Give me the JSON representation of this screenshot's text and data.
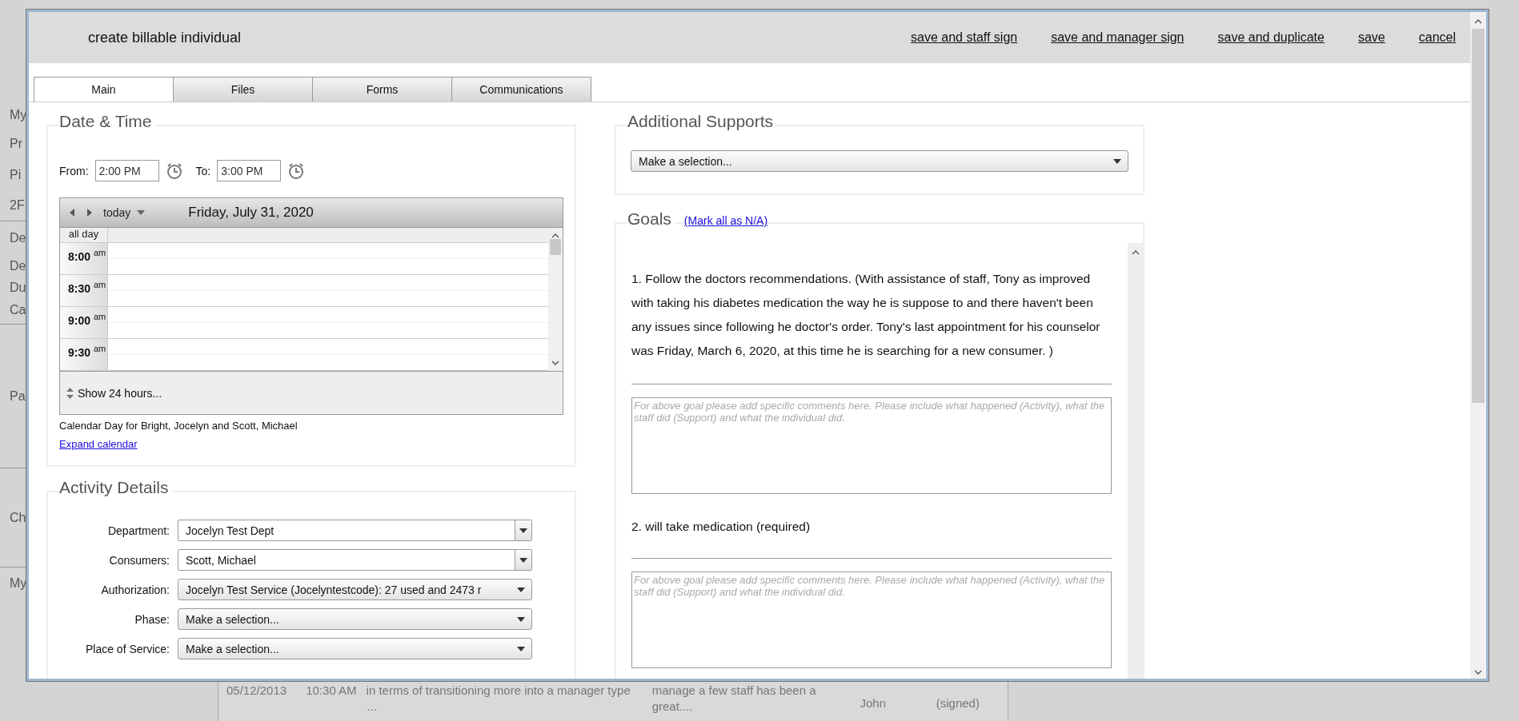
{
  "background": {
    "side_items": [
      "My",
      "Pr",
      "Pi",
      "2F",
      "De",
      "De",
      "Du",
      "Ca",
      "Pa",
      "Ch",
      "My"
    ],
    "bottom_row": {
      "date": "05/12/2013",
      "time": "10:30 AM",
      "note": "in terms of transitioning more into a manager type",
      "note_more": "...",
      "summary": "manage a few staff has been a",
      "summary_more": "great....",
      "staff": "John",
      "signed": "(signed)"
    }
  },
  "dialog": {
    "title": "create billable individual",
    "actions": [
      "save and staff sign",
      "save and manager sign",
      "save and duplicate",
      "save",
      "cancel"
    ],
    "tabs": [
      {
        "label": "Main",
        "selected": true
      },
      {
        "label": "Files",
        "selected": false
      },
      {
        "label": "Forms",
        "selected": false
      },
      {
        "label": "Communications",
        "selected": false
      }
    ],
    "date_time": {
      "title": "Date & Time",
      "from_label": "From:",
      "from_value": "2:00 PM",
      "to_label": "To:",
      "to_value": "3:00 PM",
      "calendar": {
        "today_label": "today",
        "date": "Friday, July 31, 2020",
        "all_day_label": "all day",
        "times": [
          {
            "hour": "8:00",
            "suffix": "am"
          },
          {
            "hour": "8:30",
            "suffix": "am"
          },
          {
            "hour": "9:00",
            "suffix": "am"
          },
          {
            "hour": "9:30",
            "suffix": "am"
          }
        ],
        "show_hours": "Show 24 hours...",
        "caption": "Calendar Day for Bright, Jocelyn and Scott, Michael",
        "expand_link": "Expand calendar"
      }
    },
    "activity_details": {
      "title": "Activity Details",
      "fields": [
        {
          "label": "Department:",
          "value": "Jocelyn Test Dept",
          "kind": "combo"
        },
        {
          "label": "Consumers:",
          "value": "Scott, Michael",
          "kind": "combo"
        },
        {
          "label": "Authorization:",
          "value": "Jocelyn Test Service (Jocelyntestcode): 27 used and 2473 r",
          "kind": "select"
        },
        {
          "label": "Phase:",
          "value": "Make a selection...",
          "kind": "select"
        },
        {
          "label": "Place of Service:",
          "value": "Make a selection...",
          "kind": "select"
        }
      ]
    },
    "additional_supports": {
      "title": "Additional Supports",
      "value": "Make a selection..."
    },
    "goals": {
      "title": "Goals",
      "mark_all_link": "(Mark all as N/A)",
      "items": [
        {
          "text": "1. Follow the doctors recommendations. (With assistance of staff, Tony as improved with taking his diabetes medication the way he is suppose to and there haven't been any issues since following he doctor's order. Tony's last appointment for his counselor was Friday, March 6, 2020, at this time he is searching for a new consumer. )",
          "placeholder": "For above goal please add specific comments here. Please include what happened (Activity), what the staff did (Support) and what the individual did."
        },
        {
          "text": "2. will take medication (required)",
          "placeholder": "For above goal please add specific comments here. Please include what happened (Activity), what the staff did (Support) and what the individual did."
        }
      ]
    }
  }
}
